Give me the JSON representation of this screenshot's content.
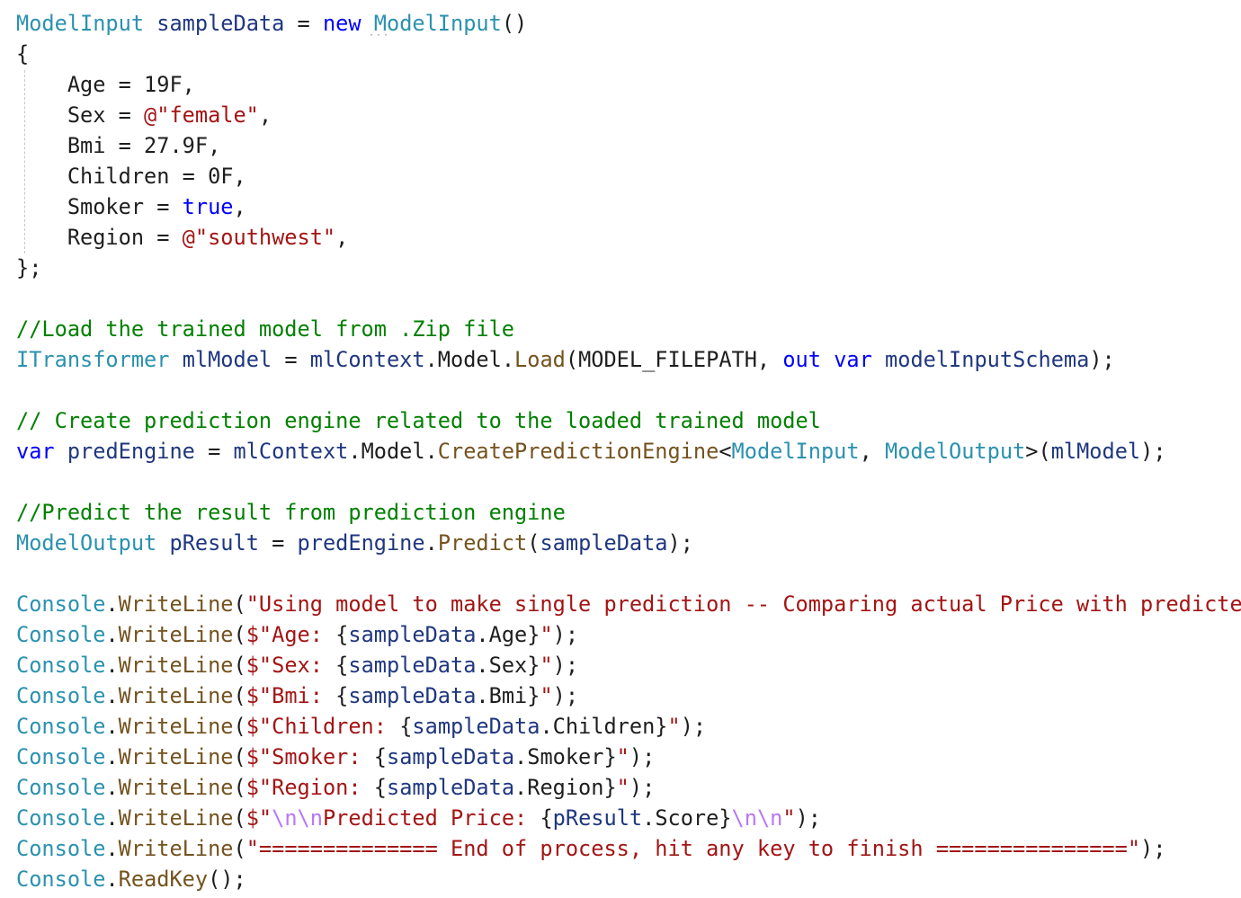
{
  "colors": {
    "background": "#ffffff",
    "plain": "#1e1e1e",
    "keyword": "#0000ff",
    "type": "#2b91af",
    "identifier": "#1f377f",
    "method": "#74531f",
    "string": "#a31515",
    "comment": "#008000",
    "escape": "#b776fb"
  },
  "token_colors": {
    "plain": "#1e1e1e",
    "kw": "#0000ff",
    "type": "#2b91af",
    "id": "#1f377f",
    "method": "#74531f",
    "str": "#a31515",
    "comment": "#008000",
    "esc": "#b776fb"
  },
  "editor": {
    "lines": [
      [
        [
          "type",
          "ModelInput"
        ],
        [
          "plain",
          " "
        ],
        [
          "id",
          "sampleData"
        ],
        [
          "plain",
          " = "
        ],
        [
          "kw",
          "new"
        ],
        [
          "plain",
          " "
        ],
        [
          "type",
          "ModelInput"
        ],
        [
          "plain",
          "()"
        ]
      ],
      [
        [
          "plain",
          "{"
        ]
      ],
      [
        [
          "plain",
          "    Age = 19F,"
        ]
      ],
      [
        [
          "plain",
          "    Sex = "
        ],
        [
          "str",
          "@\"female\""
        ],
        [
          "plain",
          ","
        ]
      ],
      [
        [
          "plain",
          "    Bmi = 27.9F,"
        ]
      ],
      [
        [
          "plain",
          "    Children = 0F,"
        ]
      ],
      [
        [
          "plain",
          "    Smoker = "
        ],
        [
          "kw",
          "true"
        ],
        [
          "plain",
          ","
        ]
      ],
      [
        [
          "plain",
          "    Region = "
        ],
        [
          "str",
          "@\"southwest\""
        ],
        [
          "plain",
          ","
        ]
      ],
      [
        [
          "plain",
          "};"
        ]
      ],
      [],
      [
        [
          "comment",
          "//Load the trained model from .Zip file"
        ]
      ],
      [
        [
          "type",
          "ITransformer"
        ],
        [
          "plain",
          " "
        ],
        [
          "id",
          "mlModel"
        ],
        [
          "plain",
          " = "
        ],
        [
          "id",
          "mlContext"
        ],
        [
          "plain",
          ".Model."
        ],
        [
          "method",
          "Load"
        ],
        [
          "plain",
          "(MODEL_FILEPATH, "
        ],
        [
          "kw",
          "out"
        ],
        [
          "plain",
          " "
        ],
        [
          "kw",
          "var"
        ],
        [
          "plain",
          " "
        ],
        [
          "id",
          "modelInputSchema"
        ],
        [
          "plain",
          ");"
        ]
      ],
      [],
      [
        [
          "comment",
          "// Create prediction engine related to the loaded trained model"
        ]
      ],
      [
        [
          "kw",
          "var"
        ],
        [
          "plain",
          " "
        ],
        [
          "id",
          "predEngine"
        ],
        [
          "plain",
          " = "
        ],
        [
          "id",
          "mlContext"
        ],
        [
          "plain",
          ".Model."
        ],
        [
          "method",
          "CreatePredictionEngine"
        ],
        [
          "plain",
          "<"
        ],
        [
          "type",
          "ModelInput"
        ],
        [
          "plain",
          ", "
        ],
        [
          "type",
          "ModelOutput"
        ],
        [
          "plain",
          ">("
        ],
        [
          "id",
          "mlModel"
        ],
        [
          "plain",
          ");"
        ]
      ],
      [],
      [
        [
          "comment",
          "//Predict the result from prediction engine"
        ]
      ],
      [
        [
          "type",
          "ModelOutput"
        ],
        [
          "plain",
          " "
        ],
        [
          "id",
          "pResult"
        ],
        [
          "plain",
          " = "
        ],
        [
          "id",
          "predEngine"
        ],
        [
          "plain",
          "."
        ],
        [
          "method",
          "Predict"
        ],
        [
          "plain",
          "("
        ],
        [
          "id",
          "sampleData"
        ],
        [
          "plain",
          ");"
        ]
      ],
      [],
      [
        [
          "type",
          "Console"
        ],
        [
          "plain",
          "."
        ],
        [
          "method",
          "WriteLine"
        ],
        [
          "plain",
          "("
        ],
        [
          "str",
          "\"Using model to make single prediction -- Comparing actual Price with predicted"
        ]
      ],
      [
        [
          "type",
          "Console"
        ],
        [
          "plain",
          "."
        ],
        [
          "method",
          "WriteLine"
        ],
        [
          "plain",
          "("
        ],
        [
          "str",
          "$\"Age: "
        ],
        [
          "plain",
          "{"
        ],
        [
          "id",
          "sampleData"
        ],
        [
          "plain",
          ".Age}"
        ],
        [
          "str",
          "\""
        ],
        [
          "plain",
          ");"
        ]
      ],
      [
        [
          "type",
          "Console"
        ],
        [
          "plain",
          "."
        ],
        [
          "method",
          "WriteLine"
        ],
        [
          "plain",
          "("
        ],
        [
          "str",
          "$\"Sex: "
        ],
        [
          "plain",
          "{"
        ],
        [
          "id",
          "sampleData"
        ],
        [
          "plain",
          ".Sex}"
        ],
        [
          "str",
          "\""
        ],
        [
          "plain",
          ");"
        ]
      ],
      [
        [
          "type",
          "Console"
        ],
        [
          "plain",
          "."
        ],
        [
          "method",
          "WriteLine"
        ],
        [
          "plain",
          "("
        ],
        [
          "str",
          "$\"Bmi: "
        ],
        [
          "plain",
          "{"
        ],
        [
          "id",
          "sampleData"
        ],
        [
          "plain",
          ".Bmi}"
        ],
        [
          "str",
          "\""
        ],
        [
          "plain",
          ");"
        ]
      ],
      [
        [
          "type",
          "Console"
        ],
        [
          "plain",
          "."
        ],
        [
          "method",
          "WriteLine"
        ],
        [
          "plain",
          "("
        ],
        [
          "str",
          "$\"Children: "
        ],
        [
          "plain",
          "{"
        ],
        [
          "id",
          "sampleData"
        ],
        [
          "plain",
          ".Children}"
        ],
        [
          "str",
          "\""
        ],
        [
          "plain",
          ");"
        ]
      ],
      [
        [
          "type",
          "Console"
        ],
        [
          "plain",
          "."
        ],
        [
          "method",
          "WriteLine"
        ],
        [
          "plain",
          "("
        ],
        [
          "str",
          "$\"Smoker: "
        ],
        [
          "plain",
          "{"
        ],
        [
          "id",
          "sampleData"
        ],
        [
          "plain",
          ".Smoker}"
        ],
        [
          "str",
          "\""
        ],
        [
          "plain",
          ");"
        ]
      ],
      [
        [
          "type",
          "Console"
        ],
        [
          "plain",
          "."
        ],
        [
          "method",
          "WriteLine"
        ],
        [
          "plain",
          "("
        ],
        [
          "str",
          "$\"Region: "
        ],
        [
          "plain",
          "{"
        ],
        [
          "id",
          "sampleData"
        ],
        [
          "plain",
          ".Region}"
        ],
        [
          "str",
          "\""
        ],
        [
          "plain",
          ");"
        ]
      ],
      [
        [
          "type",
          "Console"
        ],
        [
          "plain",
          "."
        ],
        [
          "method",
          "WriteLine"
        ],
        [
          "plain",
          "("
        ],
        [
          "str",
          "$\""
        ],
        [
          "esc",
          "\\n\\n"
        ],
        [
          "str",
          "Predicted Price: "
        ],
        [
          "plain",
          "{"
        ],
        [
          "id",
          "pResult"
        ],
        [
          "plain",
          ".Score}"
        ],
        [
          "esc",
          "\\n\\n"
        ],
        [
          "str",
          "\""
        ],
        [
          "plain",
          ");"
        ]
      ],
      [
        [
          "type",
          "Console"
        ],
        [
          "plain",
          "."
        ],
        [
          "method",
          "WriteLine"
        ],
        [
          "plain",
          "("
        ],
        [
          "str",
          "\"============== End of process, hit any key to finish ===============\""
        ],
        [
          "plain",
          ");"
        ]
      ],
      [
        [
          "type",
          "Console"
        ],
        [
          "plain",
          "."
        ],
        [
          "method",
          "ReadKey"
        ],
        [
          "plain",
          "();"
        ]
      ]
    ]
  }
}
